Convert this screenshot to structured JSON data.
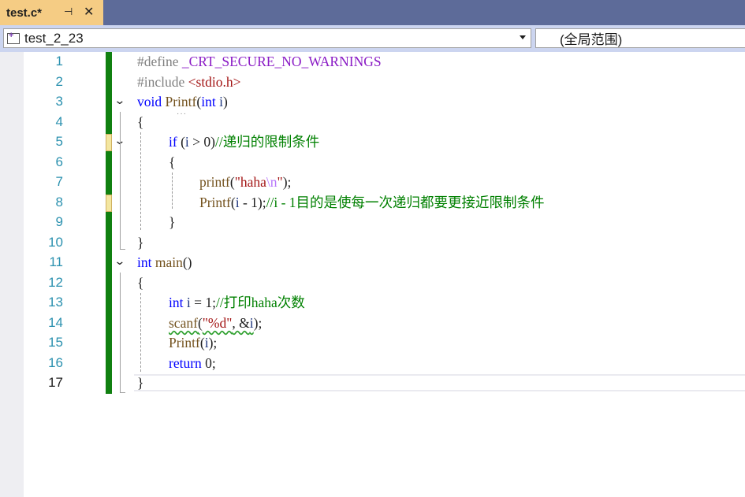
{
  "tab": {
    "title": "test.c*",
    "pin_icon": "pin-icon",
    "close_icon": "close-icon"
  },
  "navbar": {
    "project": "test_2_23",
    "scope": "(全局范围)",
    "project_icon": "project-icon"
  },
  "editor": {
    "line_numbers": [
      "1",
      "2",
      "3",
      "4",
      "5",
      "6",
      "7",
      "8",
      "9",
      "10",
      "11",
      "12",
      "13",
      "14",
      "15",
      "16",
      "17"
    ],
    "current_line": "17",
    "lines": [
      [
        "#define ",
        "_CRT_SECURE_NO_WARNINGS"
      ],
      [
        "#include ",
        "<stdio.h>"
      ],
      [
        "void",
        " ",
        "Printf",
        "(",
        "int",
        " ",
        "i",
        ")"
      ],
      [
        "{"
      ],
      [
        "if",
        " (",
        "i",
        " > 0)",
        "//递归的限制条件"
      ],
      [
        "{"
      ],
      [
        "printf",
        "(",
        "\"haha",
        "\\n",
        "\"",
        ");"
      ],
      [
        "Printf",
        "(",
        "i",
        " - 1);",
        "//i - 1目的是使每一次递归都要更接近限制条件"
      ],
      [
        "}"
      ],
      [
        "}"
      ],
      [
        "int",
        " ",
        "main",
        "()"
      ],
      [
        "{"
      ],
      [
        "int",
        " ",
        "i",
        " = 1;",
        "//打印haha次数"
      ],
      [
        "scanf",
        "(",
        "\"%d\"",
        ", &",
        "i",
        ");"
      ],
      [
        "Printf",
        "(",
        "i",
        ");"
      ],
      [
        "return",
        " 0;"
      ],
      [
        "}"
      ]
    ]
  }
}
